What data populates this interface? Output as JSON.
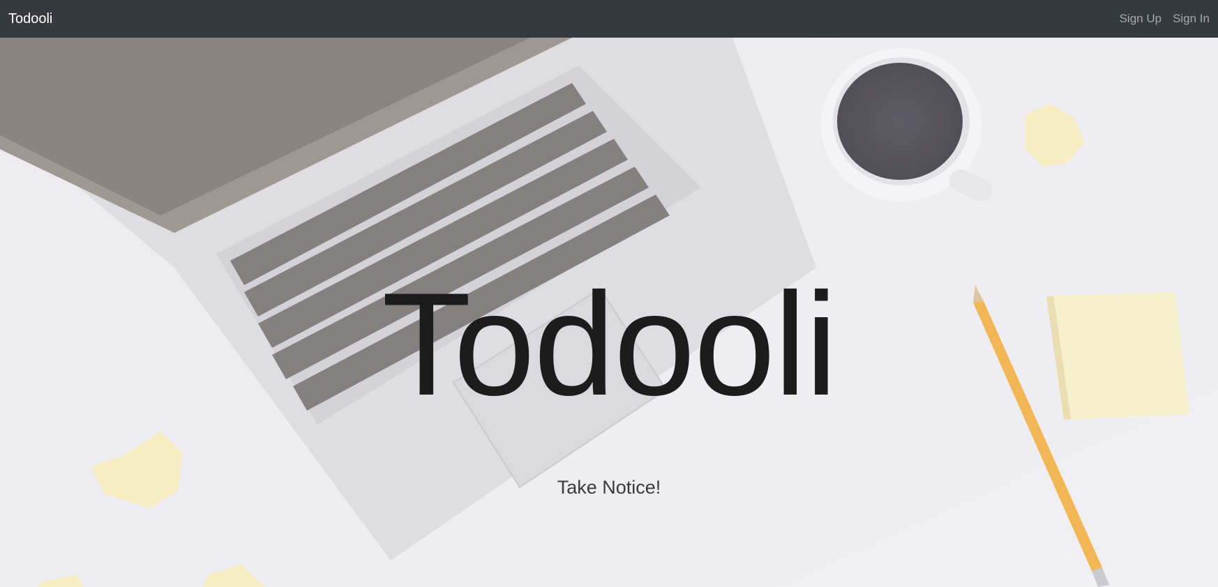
{
  "navbar": {
    "brand": "Todooli",
    "links": [
      {
        "label": "Sign Up"
      },
      {
        "label": "Sign In"
      }
    ]
  },
  "hero": {
    "title": "Todooli",
    "subtitle": "Take Notice!"
  },
  "colors": {
    "navbar_bg": "#343a40",
    "brand": "#ffffff",
    "nav_link": "#a5a8ab",
    "hero_title": "#1c1c1c",
    "hero_bg": "#e9e9ee"
  }
}
